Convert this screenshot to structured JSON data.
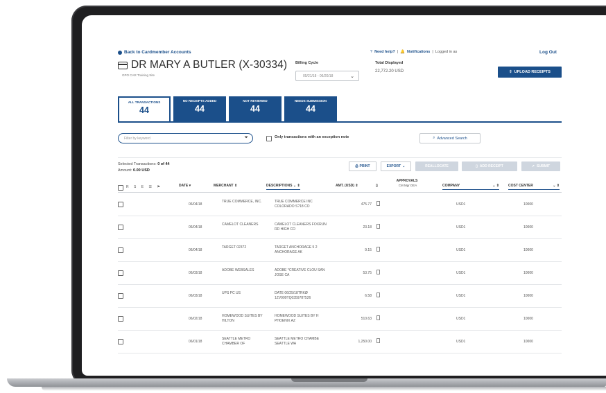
{
  "header": {
    "back_link": "Back to Cardmember Accounts",
    "cardholder_name": "DR MARY A BUTLER (X-30334)",
    "cardholder_sub": "GPO CAR Training Site",
    "billing_label": "Billing Cycle",
    "billing_value": "05/21/18 - 06/20/18",
    "total_label": "Total Displayed",
    "total_value": "22,772.20 USD",
    "need_help": "Need help?",
    "notifications": "Notifications",
    "logged_in_as": "Logged in as",
    "logout": "Log Out",
    "upload_receipts": "UPLOAD RECEIPTS"
  },
  "tabs": [
    {
      "label": "ALL TRANSACTIONS",
      "count": "44"
    },
    {
      "label": "NO RECEIPTS ADDED",
      "count": "44"
    },
    {
      "label": "NOT REVIEWED",
      "count": "44"
    },
    {
      "label": "NEEDS SUBMISSION",
      "count": "44"
    }
  ],
  "filter": {
    "placeholder": "Filter by keyword",
    "exception_label": "Only transactions with an exception note",
    "advanced_search": "Advanced Search"
  },
  "selection": {
    "selected_prefix": "Selected Transactions:",
    "selected_value": "0 of 44",
    "amount_prefix": "Amount:",
    "amount_value": "0.00 USD"
  },
  "actions": {
    "print": "PRINT",
    "export": "EXPORT",
    "reallocate": "REALLOCATE",
    "add_receipt": "ADD RECEIPT",
    "submit": "SUBMIT"
  },
  "table": {
    "icon_columns": "R S E ☰ ⚑",
    "columns": {
      "date": "DATE",
      "merchant": "MERCHANT",
      "description": "DESCRIPTIONS",
      "amount": "AMT. (USD)",
      "approvals": "APPROVALS",
      "approvals_sub": "CM  Mgr  DEA",
      "company": "COMPANY",
      "cost_center": "COST CENTER"
    },
    "rows": [
      {
        "date": "06/04/18",
        "merchant": "TRUE COMMERCE, INC.",
        "description": "TRUE COMMERCE INC COLORADO S?18 CO",
        "amount": "475.77",
        "company": "USD1",
        "cost_center": "10000"
      },
      {
        "date": "06/04/18",
        "merchant": "CAMELOT CLEANERS",
        "description": "CAMELOT CLEANERS FOXRUN RD HIGH CO",
        "amount": "23.18",
        "company": "USD1",
        "cost_center": "10000"
      },
      {
        "date": "06/04/18",
        "merchant": "TARGET 02372",
        "description": "TARGET ANCHORAGE 5 2 ANCHORAGE AK",
        "amount": "9.15",
        "company": "USD1",
        "cost_center": "10000"
      },
      {
        "date": "06/03/18",
        "merchant": "ADOBE WEBSALES",
        "description": "ADOBE *CREATIVE CLOU SAN JOSE CA",
        "amount": "53.75",
        "company": "USD1",
        "cost_center": "10000"
      },
      {
        "date": "06/03/18",
        "merchant": "UPS PC US",
        "description": "DATE 06/25/18TRKØ 1ZV999TQ0359787526",
        "amount": "6.58",
        "company": "USD1",
        "cost_center": "10000"
      },
      {
        "date": "06/02/18",
        "merchant": "HOMEWOOD SUITES BY HILTON",
        "description": "HOMEWOOD SUITES BY H PHOENIX AZ",
        "amount": "510.63",
        "company": "USD1",
        "cost_center": "10000"
      },
      {
        "date": "06/01/18",
        "merchant": "SEATTLE METRO CHAMBER OF",
        "description": "SEATTLE METRO CHAMBE SEATTLE WA",
        "amount": "1,250.00",
        "company": "USD1",
        "cost_center": "10000"
      }
    ]
  },
  "colors": {
    "primary": "#1b4f8a",
    "disabled_btn": "#cfd6df",
    "laptop_frame": "#1f1f21"
  }
}
